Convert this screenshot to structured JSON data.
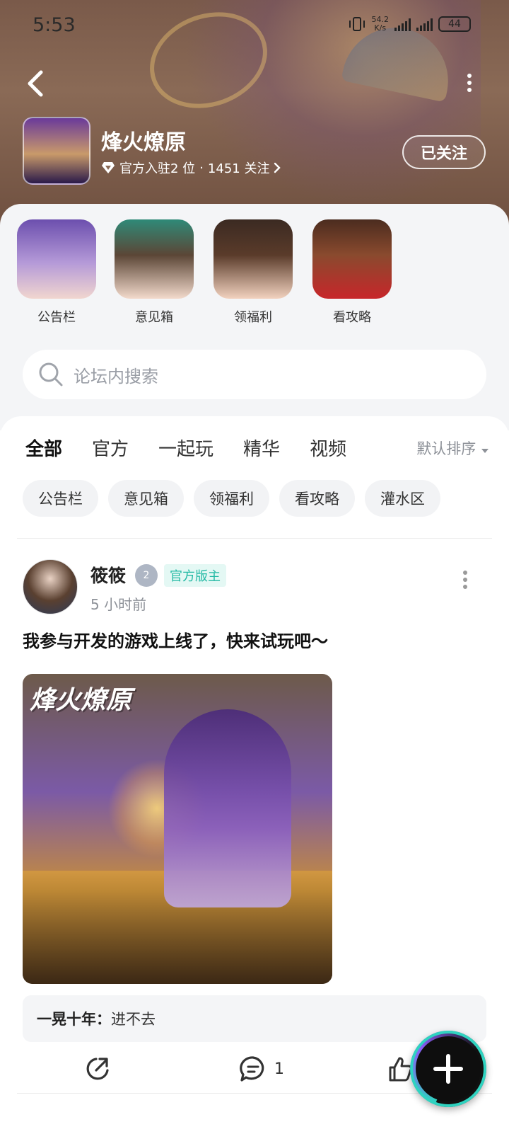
{
  "status_bar": {
    "time": "5:53",
    "net_speed_value": "54.2",
    "net_speed_unit": "K/s",
    "battery": "44"
  },
  "header": {
    "game_title": "烽火燎原",
    "official_text": "官方入驻2 位",
    "separator": "·",
    "followers_text": "1451 关注",
    "follow_button": "已关注"
  },
  "shortcuts": [
    {
      "label": "公告栏"
    },
    {
      "label": "意见箱"
    },
    {
      "label": "领福利"
    },
    {
      "label": "看攻略"
    }
  ],
  "search": {
    "placeholder": "论坛内搜索"
  },
  "tabs": [
    {
      "label": "全部",
      "active": true
    },
    {
      "label": "官方"
    },
    {
      "label": "一起玩"
    },
    {
      "label": "精华"
    },
    {
      "label": "视频"
    }
  ],
  "sort": {
    "label": "默认排序"
  },
  "chips": [
    {
      "label": "公告栏"
    },
    {
      "label": "意见箱"
    },
    {
      "label": "领福利"
    },
    {
      "label": "看攻略"
    },
    {
      "label": "灌水区"
    }
  ],
  "post": {
    "author": "筱筱",
    "level": "2",
    "role": "官方版主",
    "time": "5 小时前",
    "title": "我参与开发的游戏上线了，快来试玩吧～",
    "image_watermark": "烽火燎原",
    "comment_author": "一晃十年：",
    "comment_text": "进不去",
    "comment_count": "1"
  },
  "colors": {
    "accent": "#2fd3c0",
    "role_badge_bg": "#e4f8f4",
    "role_badge_text": "#23b9a4",
    "header_bg": "#7a5a4a"
  }
}
